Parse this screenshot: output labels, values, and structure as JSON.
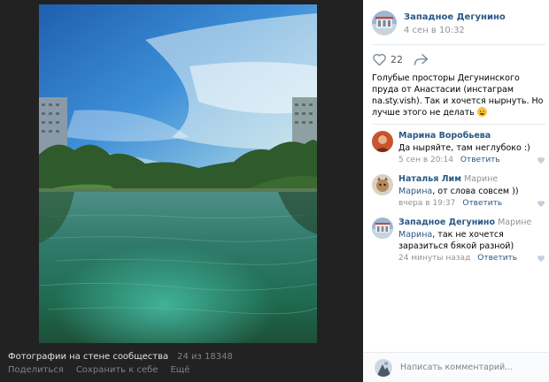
{
  "viewer": {
    "footer": {
      "title": "Фотографии на стене сообщества",
      "counter": "24 из 18348",
      "actions": [
        "Поделиться",
        "Сохранить к себе",
        "Ещё"
      ]
    }
  },
  "post": {
    "group_name": "Западное Дегунино",
    "date": "4 сен в 10:32",
    "likes": "22",
    "text": "Голубые просторы Дегунинского пруда от Анастасии (инстаграм na.sty.vish). Так и хочется нырнуть. Но лучше этого не делать"
  },
  "comments": [
    {
      "author": "Марина Воробьева",
      "reply_to": "",
      "mention": "",
      "text": "Да ныряйте, там неглубоко :)",
      "date": "5 сен в 20:14",
      "reply_label": "Ответить"
    },
    {
      "author": "Наталья Лим",
      "reply_to": "Марине",
      "mention": "Марина",
      "text": ", от слова совсем ))",
      "date": "вчера в 19:37",
      "reply_label": "Ответить"
    },
    {
      "author": "Западное Дегунино",
      "reply_to": "Марине",
      "mention": "Марина",
      "text": ", так не хочется заразиться бякой разной)",
      "date": "24 минуты назад",
      "reply_label": "Ответить"
    }
  ],
  "comment_box": {
    "placeholder": "Написать комментарий..."
  },
  "icons": {
    "like": "heart-icon",
    "share": "share-arrow-icon",
    "comment_like": "small-heart-icon"
  },
  "colors": {
    "link": "#2a5885",
    "meta": "#939393",
    "viewer_bg": "#222222"
  }
}
